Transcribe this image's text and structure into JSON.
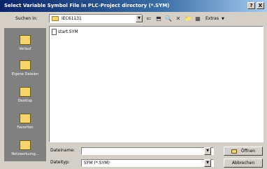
{
  "window": {
    "title": "Select Variable Symbol File in PLC-Project directory (*.SYM)",
    "help_btn": "?",
    "close_btn": "X"
  },
  "lookin": {
    "label": "Suchen in:",
    "value": "IEC61131"
  },
  "toolbar": {
    "extras_label": "Extras"
  },
  "places": [
    {
      "label": "Verlauf"
    },
    {
      "label": "Eigene Dateien"
    },
    {
      "label": "Desktop"
    },
    {
      "label": "Favoriten"
    },
    {
      "label": "Netzwerkumg..."
    }
  ],
  "files": [
    {
      "name": "start.SYM"
    }
  ],
  "filename": {
    "label": "Dateiname:",
    "value": ""
  },
  "filetype": {
    "label": "Dateityp:",
    "value": "SYM (*.SYM)"
  },
  "buttons": {
    "open": "Öffnen",
    "cancel": "Abbrechen"
  }
}
